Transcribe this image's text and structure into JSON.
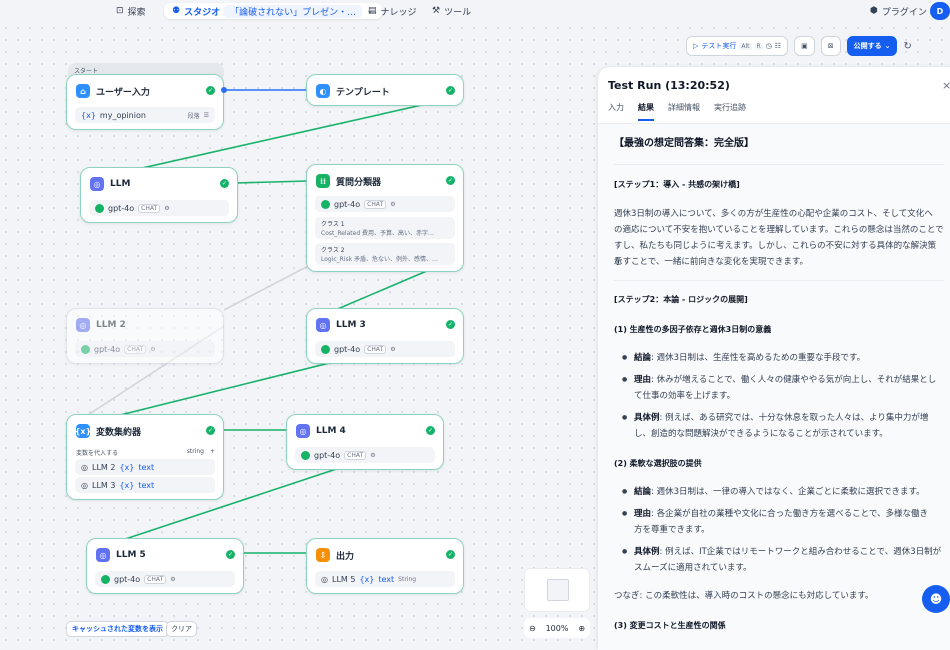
{
  "nav": {
    "explore": "探索",
    "studio": "スタジオ",
    "breadcrumb": "「論破されない」プレゼン・…",
    "knowledge": "ナレッジ",
    "tools": "ツール",
    "plugins": "プラグイン",
    "avatar": "D"
  },
  "toolbar": {
    "test_run": "テスト実行",
    "shortcut_alt": "Alt",
    "shortcut_r": "R",
    "publish": "公開する"
  },
  "nodes": {
    "start_label": "スタート",
    "user_input": {
      "title": "ユーザー入力",
      "var": "my_opinion",
      "var_type": "段落"
    },
    "template": {
      "title": "テンプレート"
    },
    "llm1": {
      "title": "LLM",
      "model": "gpt-4o",
      "mode": "CHAT"
    },
    "classifier": {
      "title": "質問分類器",
      "model": "gpt-4o",
      "mode": "CHAT",
      "class1_label": "クラス 1",
      "class1_text": "Cost_Related 費用、予算、高い、赤字…",
      "class2_label": "クラス 2",
      "class2_text": "Logic_Risk 矛盾、危ない、例外、感情、…"
    },
    "llm2": {
      "title": "LLM 2",
      "model": "gpt-4o",
      "mode": "CHAT"
    },
    "llm3": {
      "title": "LLM 3",
      "model": "gpt-4o",
      "mode": "CHAT"
    },
    "aggregator": {
      "title": "変数集約器",
      "assign_label": "変数を代入する",
      "type": "string",
      "item1_src": "LLM 2",
      "item1_var": "text",
      "item2_src": "LLM 3",
      "item2_var": "text"
    },
    "llm4": {
      "title": "LLM 4",
      "model": "gpt-4o",
      "mode": "CHAT"
    },
    "llm5": {
      "title": "LLM 5",
      "model": "gpt-4o",
      "mode": "CHAT"
    },
    "output": {
      "title": "出力",
      "src": "LLM 5",
      "var": "text",
      "type": "String"
    }
  },
  "bottom": {
    "cache_button": "キャッシュされた変数を表示",
    "clear_button": "クリア",
    "zoom": "100%"
  },
  "panel": {
    "title": "Test Run (13:20:52)",
    "tabs": [
      "入力",
      "結果",
      "詳細情報",
      "実行追跡"
    ],
    "active_tab": 1,
    "heading": "【最強の想定問答集：完全版】",
    "step1": "[ステップ1：導入 - 共感の架け橋]",
    "para1_l1": "週休3日制の導入について、多くの方が生産性の心配や企業のコスト、そして文化へ",
    "para1_l2": "の適応について不安を抱いていることを理解しています。これらの懸念は当然のことで",
    "para1_l3": "すし、私たちも同じように考えます。しかし、これらの不安に対する具体的な解決策を",
    "para1_l4": "示すことで、一緒に前向きな変化を実現できます。",
    "step2": "[ステップ2：本論 - ロジックの展開]",
    "sec1": "(1) 生産性の多因子依存と週休3日制の意義",
    "b1_label": "結論",
    "b1_text": ": 週休3日制は、生産性を高めるための重要な手段です。",
    "b2_label": "理由",
    "b2_text_l1": ": 休みが増えることで、働く人々の健康ややる気が向上し、それが結果とし",
    "b2_text_l2": "て仕事の効率を上げます。",
    "b3_label": "具体例",
    "b3_text_l1": ": 例えば、ある研究では、十分な休息を取った人々は、より集中力が増",
    "b3_text_l2": "し、創造的な問題解決ができるようになることが示されています。",
    "sec2": "(2) 柔軟な選択肢の提供",
    "c1_label": "結論",
    "c1_text": ": 週休3日制は、一律の導入ではなく、企業ごとに柔軟に選択できます。",
    "c2_label": "理由",
    "c2_text_l1": ": 各企業が自社の業種や文化に合った働き方を選べることで、多様な働き",
    "c2_text_l2": "方を尊重できます。",
    "c3_label": "具体例",
    "c3_text_l1": ": 例えば、IT企業ではリモートワークと組み合わせることで、週休3日制が",
    "c3_text_l2": "スムーズに適用されています。",
    "bridge": "つなぎ: この柔軟性は、導入時のコストの懸念にも対応しています。",
    "sec3": "(3) 変更コストと生産性の関係"
  },
  "colors": {
    "accent": "#155eef",
    "edge": "#17b26a",
    "node_border": "#8ed3c2"
  }
}
